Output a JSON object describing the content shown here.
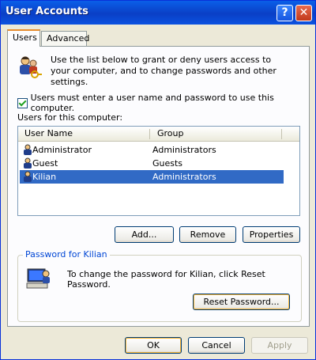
{
  "window": {
    "title": "User Accounts",
    "help_btn": "?",
    "close_btn": "✕"
  },
  "tabs": [
    {
      "label": "Users",
      "active": true
    },
    {
      "label": "Advanced",
      "active": false
    }
  ],
  "intro_text": "Use the list below to grant or deny users access to your computer, and to change passwords and other settings.",
  "checkbox": {
    "label": "Users must enter a user name and password to use this computer.",
    "checked": true
  },
  "list_label": "Users for this computer:",
  "table": {
    "columns": [
      "User Name",
      "Group"
    ],
    "rows": [
      {
        "name": "Administrator",
        "group": "Administrators",
        "selected": false
      },
      {
        "name": "Guest",
        "group": "Guests",
        "selected": false
      },
      {
        "name": "Kilian",
        "group": "Administrators",
        "selected": true
      }
    ]
  },
  "buttons": {
    "add": "Add...",
    "remove": "Remove",
    "properties": "Properties"
  },
  "password_group": {
    "title": "Password for Kilian",
    "text": "To change the password for Kilian, click Reset Password.",
    "reset_button": "Reset Password..."
  },
  "footer": {
    "ok": "OK",
    "cancel": "Cancel",
    "apply": "Apply"
  },
  "icons": {
    "users_keys": "users-key-icon",
    "user": "user-icon",
    "password": "computer-password-icon"
  }
}
